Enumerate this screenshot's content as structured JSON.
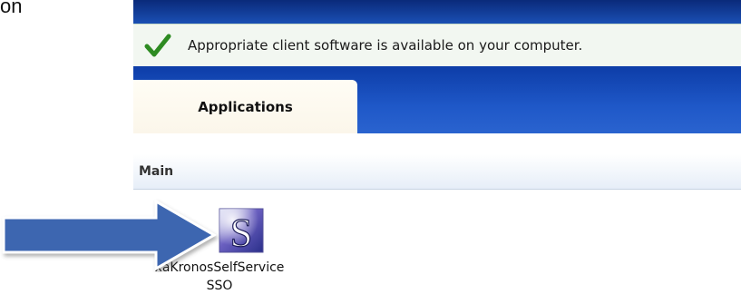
{
  "document": {
    "fragment_text": "on"
  },
  "status": {
    "icon": "checkmark-icon",
    "message": "Appropriate client software is available on your computer."
  },
  "tabs": [
    {
      "label": "Applications",
      "selected": true
    }
  ],
  "section": {
    "title": "Main"
  },
  "apps": [
    {
      "name": "xaKronosSelfService SSO",
      "line1": "xaKronosSelfService",
      "line2": "SSO",
      "icon": "letter-s-app-icon"
    }
  ],
  "annotation": {
    "arrow_color": "#3d66b0",
    "arrow_direction": "right"
  },
  "colors": {
    "header_blue": "#1f58c8",
    "status_green_bg": "#f2f7f1",
    "check_green": "#2e8b22"
  }
}
